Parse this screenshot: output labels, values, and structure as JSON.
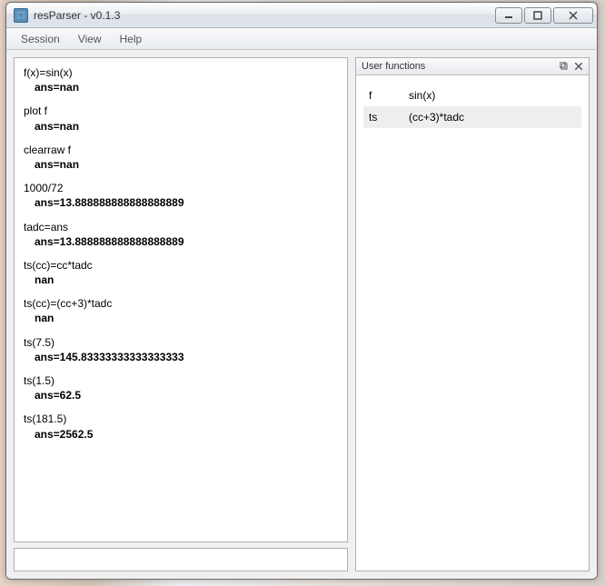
{
  "window": {
    "title": "resParser - v0.1.3"
  },
  "menu": {
    "session": "Session",
    "view": "View",
    "help": "Help"
  },
  "console": {
    "entries": [
      {
        "cmd": "f(x)=sin(x)",
        "ans": "ans=nan"
      },
      {
        "cmd": "plot f",
        "ans": "ans=nan"
      },
      {
        "cmd": "clearraw f",
        "ans": "ans=nan"
      },
      {
        "cmd": "1000/72",
        "ans": "ans=13.888888888888888889"
      },
      {
        "cmd": "tadc=ans",
        "ans": "ans=13.888888888888888889"
      },
      {
        "cmd": "ts(cc)=cc*tadc",
        "ans": "nan"
      },
      {
        "cmd": "ts(cc)=(cc+3)*tadc",
        "ans": "nan"
      },
      {
        "cmd": "ts(7.5)",
        "ans": "ans=145.83333333333333333"
      },
      {
        "cmd": "ts(1.5)",
        "ans": "ans=62.5"
      },
      {
        "cmd": "ts(181.5)",
        "ans": "ans=2562.5"
      }
    ],
    "input_value": ""
  },
  "panel": {
    "title": "User functions",
    "functions": [
      {
        "name": "f",
        "def": "sin(x)"
      },
      {
        "name": "ts",
        "def": "(cc+3)*tadc"
      }
    ]
  }
}
